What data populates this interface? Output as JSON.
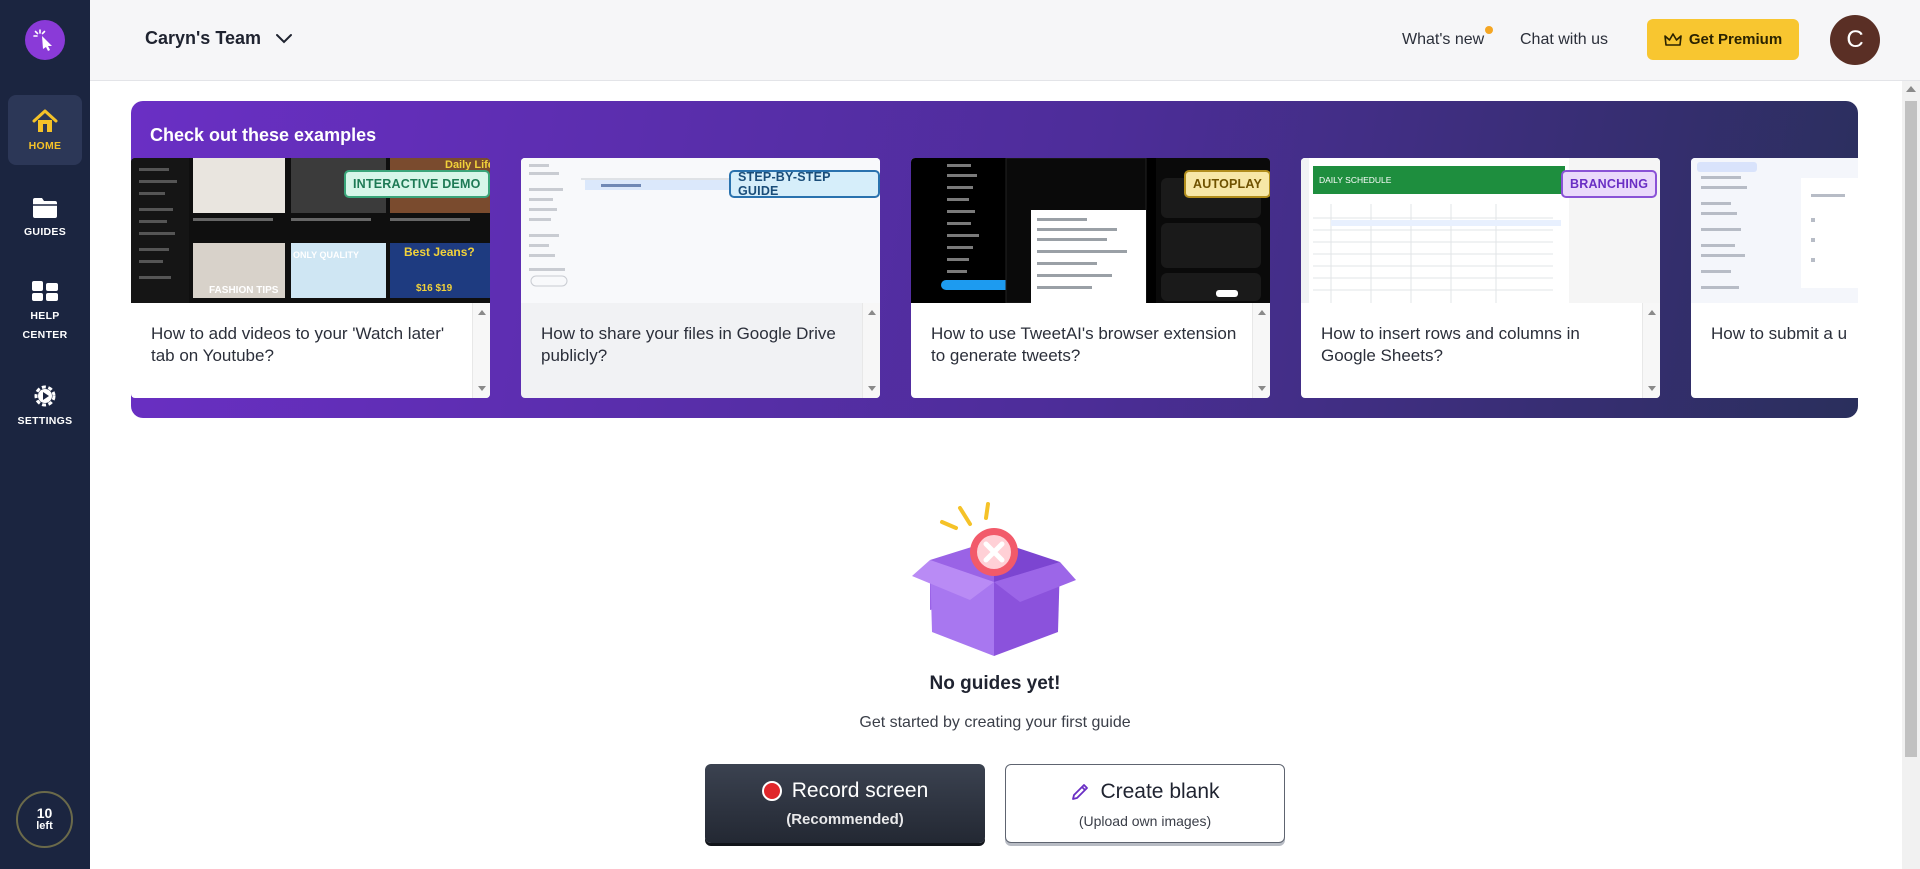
{
  "sidebar": {
    "logo_icon": "cursor-click-icon",
    "items": [
      {
        "label": "HOME",
        "icon": "home-icon",
        "active": true
      },
      {
        "label": "GUIDES",
        "icon": "folder-icon"
      },
      {
        "label_line1": "HELP",
        "label_line2": "CENTER",
        "icon": "help-grid-icon"
      },
      {
        "label": "SETTINGS",
        "icon": "gear-icon"
      }
    ],
    "credits": {
      "count": "10",
      "label": "left"
    }
  },
  "header": {
    "team_name": "Caryn's Team",
    "whats_new": "What's new",
    "chat": "Chat with us",
    "premium": "Get Premium",
    "avatar_initial": "C"
  },
  "examples": {
    "title": "Check out these examples",
    "cards": [
      {
        "tag": "INTERACTIVE DEMO",
        "title": "How to add videos to your 'Watch later' tab on Youtube?"
      },
      {
        "tag": "STEP-BY-STEP GUIDE",
        "title": "How to share your files in Google Drive publicly?"
      },
      {
        "tag": "AUTOPLAY",
        "title": "How to use TweetAI's browser extension to generate tweets?"
      },
      {
        "tag": "BRANCHING",
        "title": "How to insert rows and columns in Google Sheets?",
        "thumb_caption": "DAILY SCHEDULE"
      },
      {
        "tag": "",
        "title": "How to submit a u"
      }
    ]
  },
  "empty_state": {
    "title": "No guides yet!",
    "subtitle": "Get started by creating your first guide",
    "record_label": "Record screen",
    "record_sub": "(Recommended)",
    "blank_label": "Create blank",
    "blank_sub": "(Upload own images)"
  },
  "colors": {
    "sidebar": "#1b2540",
    "accent_yellow": "#f8c630",
    "banner_purple": "#6a2fc4"
  }
}
